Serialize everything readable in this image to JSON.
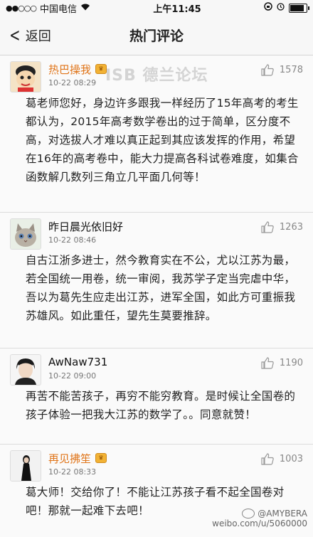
{
  "status_bar": {
    "carrier": "中国电信",
    "time": "上午11:45",
    "signal": "●●○○○"
  },
  "nav": {
    "back_label": "返回",
    "title": "热门评论"
  },
  "watermark_mid": "ISB 德兰论坛",
  "comments": [
    {
      "user": "热巴操我",
      "time": "10-22 08:29",
      "likes": "1578",
      "text": "葛老师您好，身边许多跟我一样经历了15年高考的考生都认为，2015年高考数学卷出的过于简单，区分度不高，对选拔人才难以真正起到其应该发挥的作用，希望在16年的高考卷中，能大力提高各科试卷难度，如集合函数解几数列三角立几平面几何等！"
    },
    {
      "user": "昨日晨光依旧好",
      "time": "10-22 08:46",
      "likes": "1263",
      "text": "自古江浙多进士，然今教育实在不公，尤以江苏为最，若全国统一用卷，统一审阅，我苏学子定当完虐中华，吾以为葛先生应走出江苏，进军全国，如此方可重振我苏雄风。如此重任，望先生莫要推辞。"
    },
    {
      "user": "AwNaw731",
      "time": "10-22 09:00",
      "likes": "1190",
      "text": "再苦不能苦孩子，再穷不能穷教育。是时候让全国卷的孩子体验一把我大江苏的数学了。。同意就赞！"
    },
    {
      "user": "再见拂笙",
      "time": "10-22 08:33",
      "likes": "1003",
      "text": "葛大师！交给你了！不能让江苏孩子看不起全国卷对吧！那就一起难下去吧！"
    }
  ],
  "footer": {
    "handle": "@AMYBERA",
    "url": "weibo.com/u/5060000"
  }
}
